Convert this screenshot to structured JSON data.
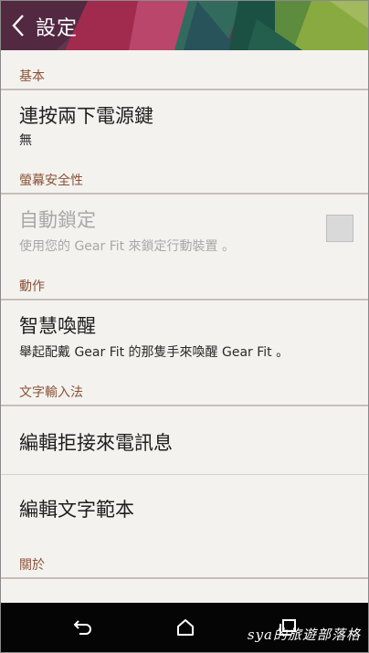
{
  "app_bar": {
    "title": "設定",
    "back_icon": "chevron-left-icon"
  },
  "sections": {
    "basic": {
      "header": "基本",
      "double_press_power": {
        "title": "連按兩下電源鍵",
        "value": "無"
      }
    },
    "screen_security": {
      "header": "螢幕安全性",
      "auto_lock": {
        "title": "自動鎖定",
        "description": "使用您的 Gear Fit 來鎖定行動裝置 。",
        "checked": false,
        "enabled": false
      }
    },
    "motion": {
      "header": "動作",
      "smart_wake": {
        "title": "智慧喚醒",
        "description": "舉起配戴 Gear Fit 的那隻手來喚醒 Gear Fit 。"
      }
    },
    "text_input": {
      "header": "文字輸入法",
      "edit_reject_messages": {
        "title": "編輯拒接來電訊息"
      },
      "edit_text_templates": {
        "title": "編輯文字範本"
      }
    },
    "about": {
      "header": "關於"
    }
  },
  "nav_bar": {
    "back_icon": "back-arrow-icon",
    "home_icon": "home-icon",
    "recents_icon": "recents-icon",
    "watermark": "sya的旅遊部落格"
  },
  "colors": {
    "section_header_text": "#8a5238",
    "background": "#f4f2ee",
    "nav_bar": "#050505"
  }
}
